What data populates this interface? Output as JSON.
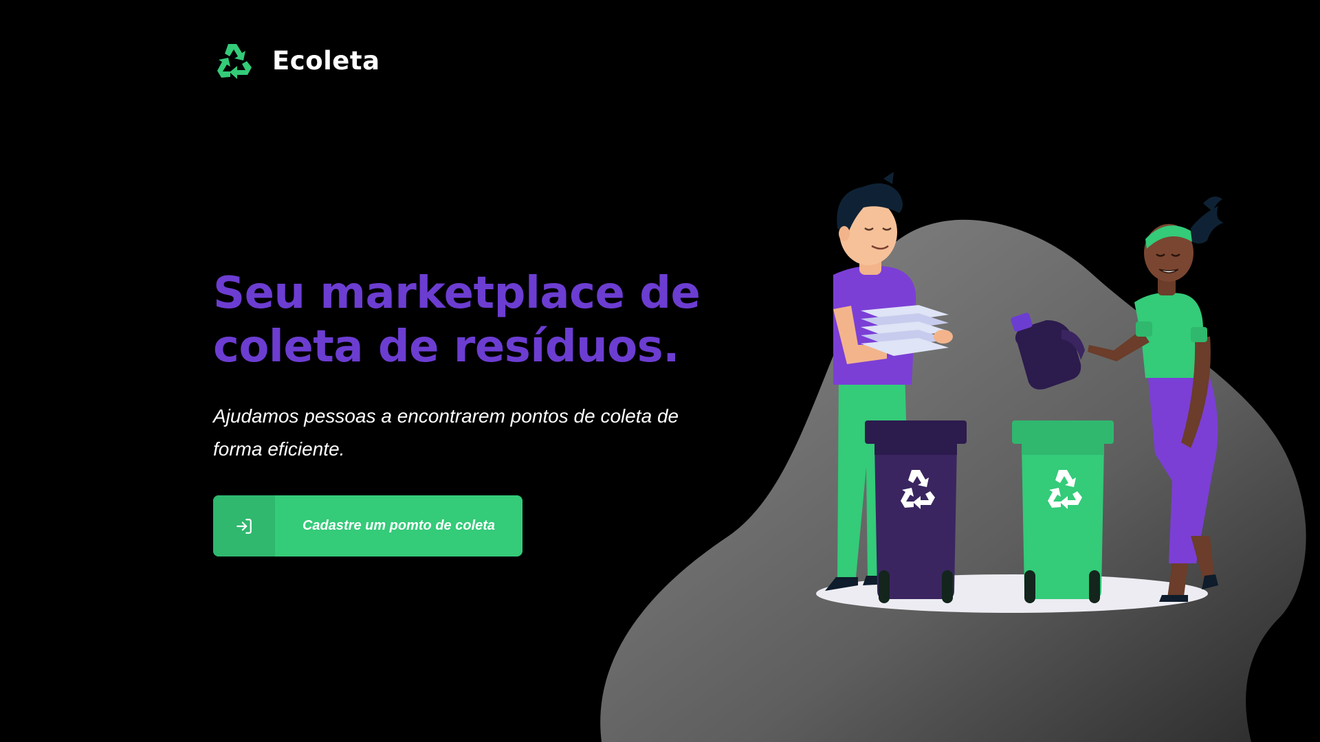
{
  "header": {
    "logo_icon": "recycle-icon",
    "brand_name": "Ecoleta"
  },
  "hero": {
    "title": "Seu marketplace de coleta de resíduos.",
    "subtitle": "Ajudamos pessoas a encontrarem pontos de coleta de forma eficiente."
  },
  "cta": {
    "icon": "log-in-icon",
    "label": "Cadastre um pomto de coleta"
  },
  "colors": {
    "background": "#000000",
    "accent_purple": "#6c3dd1",
    "accent_green": "#34cb79",
    "accent_green_dark": "#2fb86e",
    "bin_dark": "#3a2560"
  },
  "illustration": {
    "subject": "recycling-illustration"
  }
}
